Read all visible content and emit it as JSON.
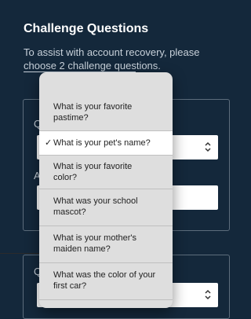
{
  "header": {
    "title": "Challenge Questions",
    "description": "To assist with account recovery, please choose 2 challenge questions."
  },
  "icons": {
    "checkmark": "checkmark-icon",
    "chevron": "chevron-up-down-icon"
  },
  "dropdown": {
    "selected_index": 1,
    "options": [
      "What is your favorite pastime?",
      "What is your pet's name?",
      "What is your favorite color?",
      "What was your school mascot?",
      "What is your mother's maiden name?",
      "What was the color of your first car?"
    ]
  },
  "colors": {
    "background": "#14283b",
    "menu": "#dedede",
    "selected_row": "#ffffff"
  }
}
